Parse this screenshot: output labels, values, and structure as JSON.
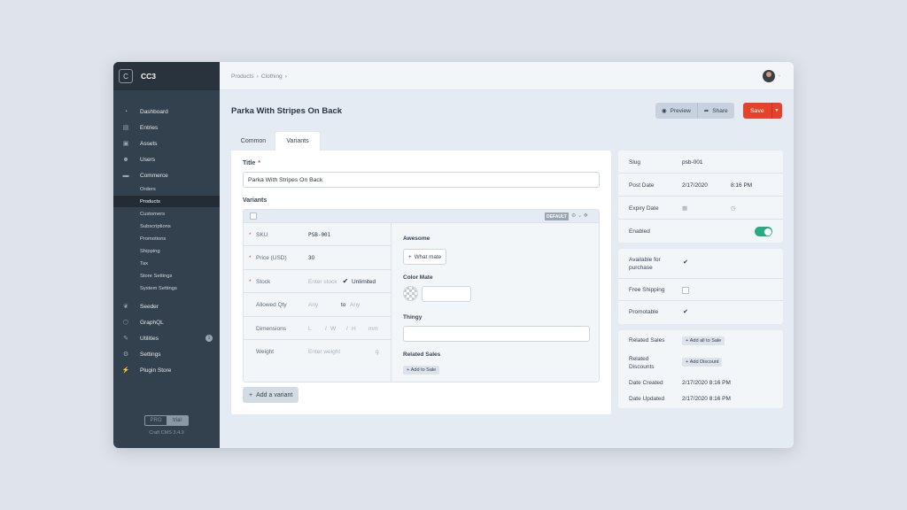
{
  "sidebar": {
    "logo_letter": "C",
    "site_name": "CC3",
    "items": [
      {
        "label": "Dashboard",
        "icon": "gauge-icon"
      },
      {
        "label": "Entries",
        "icon": "entries-icon"
      },
      {
        "label": "Assets",
        "icon": "image-icon"
      },
      {
        "label": "Users",
        "icon": "users-icon"
      },
      {
        "label": "Commerce",
        "icon": "commerce-icon"
      }
    ],
    "commerce_sub": [
      "Orders",
      "Products",
      "Customers",
      "Subscriptions",
      "Promotions",
      "Shipping",
      "Tax",
      "Store Settings",
      "System Settings"
    ],
    "items2": [
      {
        "label": "Seeder",
        "icon": "leaf-icon"
      },
      {
        "label": "GraphQL",
        "icon": "graphql-icon"
      },
      {
        "label": "Utilities",
        "icon": "wrench-icon",
        "badge": "1"
      },
      {
        "label": "Settings",
        "icon": "gear-icon"
      },
      {
        "label": "Plugin Store",
        "icon": "plug-icon"
      }
    ],
    "edition": {
      "pro": "PRO",
      "trial": "trial"
    },
    "version": "Craft CMS 3.4.9"
  },
  "breadcrumb": [
    "Products",
    "Clothing"
  ],
  "page_title": "Parka With Stripes On Back",
  "actions": {
    "preview": "Preview",
    "share": "Share",
    "save": "Save"
  },
  "tabs": [
    "Common",
    "Variants"
  ],
  "form": {
    "title_label": "Title",
    "title_value": "Parka With Stripes On Back",
    "variants_label": "Variants",
    "default_badge": "DEFAULT",
    "fields": {
      "sku_label": "SKU",
      "sku_value": "PSB-001",
      "price_label": "Price (USD)",
      "price_value": "30",
      "stock_label": "Stock",
      "stock_placeholder": "Enter stock",
      "unlimited": "Unlimited",
      "qty_label": "Allowed Qty",
      "qty_min": "Any",
      "qty_to": "to",
      "qty_max": "Any",
      "dim_label": "Dimensions",
      "dim_l": "L",
      "dim_w": "W",
      "dim_h": "H",
      "dim_unit": "mm",
      "weight_label": "Weight",
      "weight_placeholder": "Enter weight",
      "weight_unit": "g"
    },
    "right": {
      "awesome_label": "Awesome",
      "what_mate": "What mate",
      "color_label": "Color Mate",
      "thingy_label": "Thingy",
      "related_label": "Related Sales",
      "add_to_sale": "Add to Sale"
    },
    "add_variant": "Add a variant"
  },
  "meta": {
    "slug_label": "Slug",
    "slug_value": "psb-001",
    "post_date_label": "Post Date",
    "post_date": "2/17/2020",
    "post_time": "8:16 PM",
    "expiry_label": "Expiry Date",
    "enabled_label": "Enabled",
    "enabled": true
  },
  "purchase": {
    "available_label": "Available for purchase",
    "available": true,
    "free_label": "Free Shipping",
    "free": false,
    "promo_label": "Promotable",
    "promo": true
  },
  "info": {
    "related_sales_label": "Related Sales",
    "add_all_to_sale": "Add all to Sale",
    "related_discounts_label": "Related Discounts",
    "add_discount": "Add Discount",
    "created_label": "Date Created",
    "created": "2/17/2020 8:16 PM",
    "updated_label": "Date Updated",
    "updated": "2/17/2020 8:16 PM"
  },
  "colors": {
    "accent": "#e5422b",
    "toggle": "#27ab83",
    "sidebar": "#33404d"
  }
}
